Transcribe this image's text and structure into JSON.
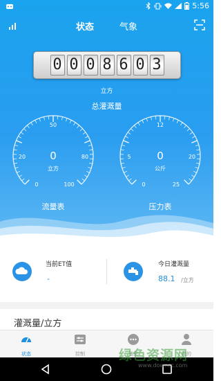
{
  "status_bar": {
    "time": "5:56"
  },
  "header": {
    "tabs": [
      {
        "label": "状态",
        "active": true
      },
      {
        "label": "气象",
        "active": false
      }
    ]
  },
  "counter": {
    "digits": [
      "0",
      "0",
      "0",
      "8",
      "6",
      "0",
      "3"
    ],
    "unit": "立方",
    "label": "总灌溉量"
  },
  "gauges": [
    {
      "name": "流量表",
      "value": "0",
      "unit": "立方",
      "ticks": [
        "0",
        "20",
        "50",
        "80",
        "100"
      ]
    },
    {
      "name": "压力表",
      "value": "0",
      "unit": "公斤",
      "ticks": [
        "0",
        "5",
        "12",
        "20",
        "25"
      ]
    }
  ],
  "info": {
    "et": {
      "label": "当前ET值",
      "value": "-"
    },
    "today": {
      "label": "今日灌溉量",
      "value": "88.1",
      "unit": "/立方"
    }
  },
  "section": {
    "title": "灌溉量/立方"
  },
  "bottom_nav": [
    {
      "label": "状态",
      "icon": "gauge-icon",
      "active": true
    },
    {
      "label": "控制",
      "icon": "control-icon",
      "active": false
    },
    {
      "label": "消息",
      "icon": "message-icon",
      "active": false
    },
    {
      "label": "我的",
      "icon": "user-icon",
      "active": false
    }
  ],
  "watermark": {
    "text": "绿色资源网",
    "url": "www.downcc.com"
  },
  "colors": {
    "primary": "#1aa3ee",
    "accent": "#1f8fe0"
  }
}
